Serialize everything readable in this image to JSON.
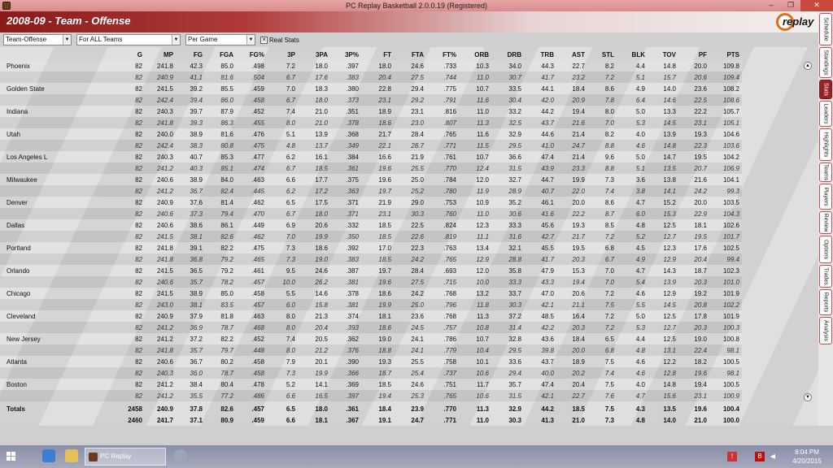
{
  "window": {
    "title": "PC Replay Basketball 2.0.0.19 (Registered)",
    "minimize": "‒",
    "maximize": "❐",
    "close": "✕"
  },
  "header": {
    "title": "2008-09 - Team - Offense",
    "logo": "replay"
  },
  "filters": {
    "category": "Team-Offense",
    "scope": "For ALL Teams",
    "mode": "Per Game",
    "real_stats_label": "Real Stats",
    "real_stats_checked": "✕"
  },
  "table": {
    "columns": [
      "",
      "G",
      "MP",
      "FG",
      "FGA",
      "FG%",
      "3P",
      "3PA",
      "3P%",
      "FT",
      "FTA",
      "FT%",
      "ORB",
      "DRB",
      "TRB",
      "AST",
      "STL",
      "BLK",
      "TOV",
      "PF",
      "PTS"
    ],
    "rows": [
      {
        "team": "Phoenix",
        "a": [
          "82",
          "241.8",
          "42.3",
          "85.0",
          ".498",
          "7.2",
          "18.0",
          ".397",
          "18.0",
          "24.6",
          ".733",
          "10.3",
          "34.0",
          "44.3",
          "22.7",
          "8.2",
          "4.4",
          "14.8",
          "20.0",
          "109.8"
        ],
        "b": [
          "82",
          "240.9",
          "41.1",
          "81.6",
          ".504",
          "6.7",
          "17.6",
          ".383",
          "20.4",
          "27.5",
          ".744",
          "11.0",
          "30.7",
          "41.7",
          "23.2",
          "7.2",
          "5.1",
          "15.7",
          "20.6",
          "109.4"
        ]
      },
      {
        "team": "Golden State",
        "a": [
          "82",
          "241.5",
          "39.2",
          "85.5",
          ".459",
          "7.0",
          "18.3",
          ".380",
          "22.8",
          "29.4",
          ".775",
          "10.7",
          "33.5",
          "44.1",
          "18.4",
          "8.6",
          "4.9",
          "14.0",
          "23.6",
          "108.2"
        ],
        "b": [
          "82",
          "242.4",
          "39.4",
          "86.0",
          ".458",
          "6.7",
          "18.0",
          ".373",
          "23.1",
          "29.2",
          ".791",
          "11.6",
          "30.4",
          "42.0",
          "20.9",
          "7.8",
          "6.4",
          "14.6",
          "22.5",
          "108.6"
        ]
      },
      {
        "team": "Indiana",
        "a": [
          "82",
          "240.3",
          "39.7",
          "87.9",
          ".452",
          "7.4",
          "21.0",
          ".351",
          "18.9",
          "23.1",
          ".816",
          "11.0",
          "33.2",
          "44.2",
          "19.4",
          "8.0",
          "5.0",
          "13.3",
          "22.2",
          "105.7"
        ],
        "b": [
          "82",
          "241.8",
          "39.3",
          "86.3",
          ".455",
          "8.0",
          "21.0",
          ".378",
          "18.6",
          "23.0",
          ".807",
          "11.3",
          "32.5",
          "43.7",
          "21.6",
          "7.0",
          "5.3",
          "14.5",
          "23.1",
          "105.1"
        ]
      },
      {
        "team": "Utah",
        "a": [
          "82",
          "240.0",
          "38.9",
          "81.6",
          ".476",
          "5.1",
          "13.9",
          ".368",
          "21.7",
          "28.4",
          ".765",
          "11.6",
          "32.9",
          "44.6",
          "21.4",
          "8.2",
          "4.0",
          "13.9",
          "19.3",
          "104.6"
        ],
        "b": [
          "82",
          "242.4",
          "38.3",
          "80.8",
          ".475",
          "4.8",
          "13.7",
          ".349",
          "22.1",
          "28.7",
          ".771",
          "11.5",
          "29.5",
          "41.0",
          "24.7",
          "8.8",
          "4.6",
          "14.8",
          "22.3",
          "103.6"
        ]
      },
      {
        "team": "Los Angeles L",
        "a": [
          "82",
          "240.3",
          "40.7",
          "85.3",
          ".477",
          "6.2",
          "16.1",
          ".384",
          "16.6",
          "21.9",
          ".761",
          "10.7",
          "36.6",
          "47.4",
          "21.4",
          "9.6",
          "5.0",
          "14.7",
          "19.5",
          "104.2"
        ],
        "b": [
          "82",
          "241.2",
          "40.3",
          "85.1",
          ".474",
          "6.7",
          "18.5",
          ".361",
          "19.6",
          "25.5",
          ".770",
          "12.4",
          "31.5",
          "43.9",
          "23.3",
          "8.8",
          "5.1",
          "13.5",
          "20.7",
          "106.9"
        ]
      },
      {
        "team": "Milwaukee",
        "a": [
          "82",
          "240.6",
          "38.9",
          "84.0",
          ".463",
          "6.6",
          "17.7",
          ".375",
          "19.6",
          "25.0",
          ".784",
          "12.0",
          "32.7",
          "44.7",
          "19.9",
          "7.3",
          "3.6",
          "13.8",
          "21.6",
          "104.1"
        ],
        "b": [
          "82",
          "241.2",
          "36.7",
          "82.4",
          ".445",
          "6.2",
          "17.2",
          ".363",
          "19.7",
          "25.2",
          ".780",
          "11.9",
          "28.9",
          "40.7",
          "22.0",
          "7.4",
          "3.8",
          "14.1",
          "24.2",
          "99.3"
        ]
      },
      {
        "team": "Denver",
        "a": [
          "82",
          "240.9",
          "37.6",
          "81.4",
          ".462",
          "6.5",
          "17.5",
          ".371",
          "21.9",
          "29.0",
          ".753",
          "10.9",
          "35.2",
          "46.1",
          "20.0",
          "8.6",
          "4.7",
          "15.2",
          "20.0",
          "103.5"
        ],
        "b": [
          "82",
          "240.6",
          "37.3",
          "79.4",
          ".470",
          "6.7",
          "18.0",
          ".371",
          "23.1",
          "30.3",
          ".760",
          "11.0",
          "30.6",
          "41.6",
          "22.2",
          "8.7",
          "6.0",
          "15.3",
          "22.9",
          "104.3"
        ]
      },
      {
        "team": "Dallas",
        "a": [
          "82",
          "240.6",
          "38.6",
          "86.1",
          ".449",
          "6.9",
          "20.6",
          ".332",
          "18.5",
          "22.5",
          ".824",
          "12.3",
          "33.3",
          "45.6",
          "19.3",
          "8.5",
          "4.8",
          "12.5",
          "18.1",
          "102.6"
        ],
        "b": [
          "82",
          "241.5",
          "38.1",
          "82.6",
          ".462",
          "7.0",
          "19.9",
          ".350",
          "18.5",
          "22.6",
          ".819",
          "11.1",
          "31.6",
          "42.7",
          "21.7",
          "7.2",
          "5.2",
          "12.7",
          "19.5",
          "101.7"
        ]
      },
      {
        "team": "Portland",
        "a": [
          "82",
          "241.8",
          "39.1",
          "82.2",
          ".475",
          "7.3",
          "18.6",
          ".392",
          "17.0",
          "22.3",
          ".763",
          "13.4",
          "32.1",
          "45.5",
          "19.5",
          "6.8",
          "4.5",
          "12.3",
          "17.6",
          "102.5"
        ],
        "b": [
          "82",
          "241.8",
          "36.8",
          "79.2",
          ".465",
          "7.3",
          "19.0",
          ".383",
          "18.5",
          "24.2",
          ".765",
          "12.9",
          "28.8",
          "41.7",
          "20.3",
          "6.7",
          "4.9",
          "12.9",
          "20.4",
          "99.4"
        ]
      },
      {
        "team": "Orlando",
        "a": [
          "82",
          "241.5",
          "36.5",
          "79.2",
          ".461",
          "9.5",
          "24.6",
          ".387",
          "19.7",
          "28.4",
          ".693",
          "12.0",
          "35.8",
          "47.9",
          "15.3",
          "7.0",
          "4.7",
          "14.3",
          "18.7",
          "102.3"
        ],
        "b": [
          "82",
          "240.6",
          "35.7",
          "78.2",
          ".457",
          "10.0",
          "26.2",
          ".381",
          "19.6",
          "27.5",
          ".715",
          "10.0",
          "33.3",
          "43.3",
          "19.4",
          "7.0",
          "5.4",
          "13.9",
          "20.3",
          "101.0"
        ]
      },
      {
        "team": "Chicago",
        "a": [
          "82",
          "241.5",
          "38.9",
          "85.0",
          ".458",
          "5.5",
          "14.6",
          ".378",
          "18.6",
          "24.2",
          ".768",
          "13.2",
          "33.7",
          "47.0",
          "20.6",
          "7.2",
          "4.6",
          "12.9",
          "19.2",
          "101.9"
        ],
        "b": [
          "82",
          "243.0",
          "38.1",
          "83.5",
          ".457",
          "6.0",
          "15.8",
          ".381",
          "19.9",
          "25.0",
          ".796",
          "11.8",
          "30.3",
          "42.1",
          "21.1",
          "7.5",
          "5.5",
          "14.5",
          "20.8",
          "102.2"
        ]
      },
      {
        "team": "Cleveland",
        "a": [
          "82",
          "240.9",
          "37.9",
          "81.8",
          ".463",
          "8.0",
          "21.3",
          ".374",
          "18.1",
          "23.6",
          ".768",
          "11.3",
          "37.2",
          "48.5",
          "16.4",
          "7.2",
          "5.0",
          "12.5",
          "17.8",
          "101.9"
        ],
        "b": [
          "82",
          "241.2",
          "36.9",
          "78.7",
          ".468",
          "8.0",
          "20.4",
          ".393",
          "18.6",
          "24.5",
          ".757",
          "10.8",
          "31.4",
          "42.2",
          "20.3",
          "7.2",
          "5.3",
          "12.7",
          "20.3",
          "100.3"
        ]
      },
      {
        "team": "New Jersey",
        "a": [
          "82",
          "241.2",
          "37.2",
          "82.2",
          ".452",
          "7.4",
          "20.5",
          ".362",
          "19.0",
          "24.1",
          ".786",
          "10.7",
          "32.8",
          "43.6",
          "18.4",
          "6.5",
          "4.4",
          "12.5",
          "19.0",
          "100.8"
        ],
        "b": [
          "82",
          "241.8",
          "35.7",
          "79.7",
          ".448",
          "8.0",
          "21.2",
          ".376",
          "18.8",
          "24.1",
          ".779",
          "10.4",
          "29.5",
          "39.8",
          "20.0",
          "6.8",
          "4.8",
          "13.1",
          "22.4",
          "98.1"
        ]
      },
      {
        "team": "Atlanta",
        "a": [
          "82",
          "240.6",
          "36.7",
          "80.2",
          ".458",
          "7.9",
          "20.1",
          ".390",
          "19.3",
          "25.5",
          ".758",
          "10.1",
          "33.6",
          "43.7",
          "18.9",
          "7.5",
          "4.6",
          "12.2",
          "18.2",
          "100.5"
        ],
        "b": [
          "82",
          "240.3",
          "36.0",
          "78.7",
          ".458",
          "7.3",
          "19.9",
          ".366",
          "18.7",
          "25.4",
          ".737",
          "10.6",
          "29.4",
          "40.0",
          "20.2",
          "7.4",
          "4.6",
          "12.8",
          "19.6",
          "98.1"
        ]
      },
      {
        "team": "Boston",
        "a": [
          "82",
          "241.2",
          "38.4",
          "80.4",
          ".478",
          "5.2",
          "14.1",
          ".369",
          "18.5",
          "24.6",
          ".751",
          "11.7",
          "35.7",
          "47.4",
          "20.4",
          "7.5",
          "4.0",
          "14.8",
          "19.4",
          "100.5"
        ],
        "b": [
          "82",
          "241.2",
          "35.5",
          "77.2",
          ".486",
          "6.6",
          "16.5",
          ".397",
          "19.4",
          "25.3",
          ".765",
          "10.6",
          "31.5",
          "42.1",
          "22.7",
          "7.6",
          "4.7",
          "15.6",
          "23.1",
          "100.9"
        ]
      }
    ],
    "totals": {
      "label": "Totals",
      "a": [
        "2458",
        "240.9",
        "37.8",
        "82.6",
        ".457",
        "6.5",
        "18.0",
        ".361",
        "18.4",
        "23.9",
        ".770",
        "11.3",
        "32.9",
        "44.2",
        "18.5",
        "7.5",
        "4.3",
        "13.5",
        "19.6",
        "100.4"
      ],
      "b": [
        "2460",
        "241.7",
        "37.1",
        "80.9",
        ".459",
        "6.6",
        "18.1",
        ".367",
        "19.1",
        "24.7",
        ".771",
        "11.0",
        "30.3",
        "41.3",
        "21.0",
        "7.3",
        "4.8",
        "14.0",
        "21.0",
        "100.0"
      ]
    }
  },
  "side_tabs": [
    "Schedule",
    "Standings",
    "Stats",
    "Leaders",
    "Highlights",
    "Teams",
    "Players",
    "Review",
    "Options",
    "Trades",
    "Reports",
    "Analysis"
  ],
  "active_tab": "Stats",
  "taskbar": {
    "app_label": "PC Replay Basketball...",
    "time": "8:04 PM",
    "date": "4/20/2015"
  }
}
